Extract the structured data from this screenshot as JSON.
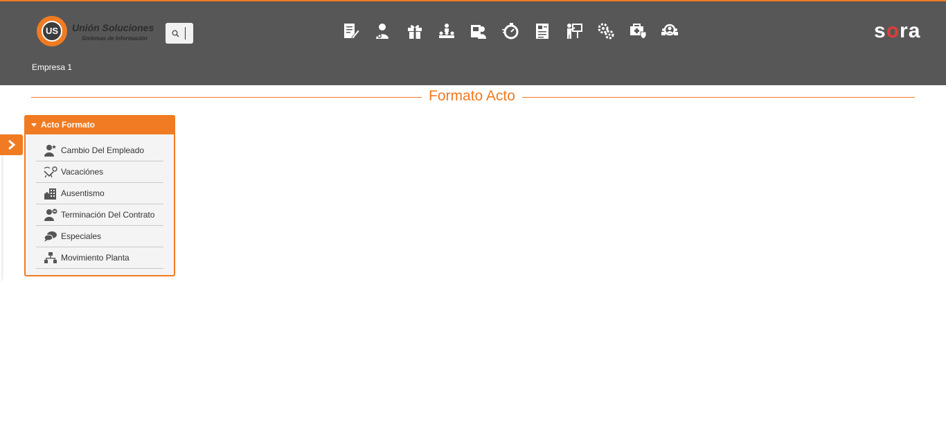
{
  "header": {
    "logo_title": "Unión Soluciones",
    "logo_subtitle": "Sistemas de Información",
    "logo_initials": "US",
    "brand": "sora",
    "company": "Empresa 1",
    "modules": [
      "document-edit-icon",
      "employee-icon",
      "gift-icon",
      "org-hierarchy-icon",
      "id-badge-icon",
      "timer-icon",
      "report-icon",
      "training-icon",
      "settings-gears-icon",
      "health-kit-icon",
      "group-search-icon"
    ]
  },
  "page": {
    "title": "Formato Acto"
  },
  "panel": {
    "title": "Acto Formato",
    "items": [
      {
        "label": "Cambio Del Empleado",
        "icon": "user-star-icon"
      },
      {
        "label": "Vacaciónes",
        "icon": "beach-chair-icon"
      },
      {
        "label": "Ausentismo",
        "icon": "building-icon"
      },
      {
        "label": "Terminación Del Contrato",
        "icon": "user-remove-icon"
      },
      {
        "label": "Especiales",
        "icon": "chat-bubbles-icon"
      },
      {
        "label": "Movimiento Planta",
        "icon": "hierarchy-icon"
      }
    ]
  },
  "colors": {
    "accent": "#f07b22",
    "header_bg": "#575757",
    "brand_accent": "#e23b3b"
  }
}
